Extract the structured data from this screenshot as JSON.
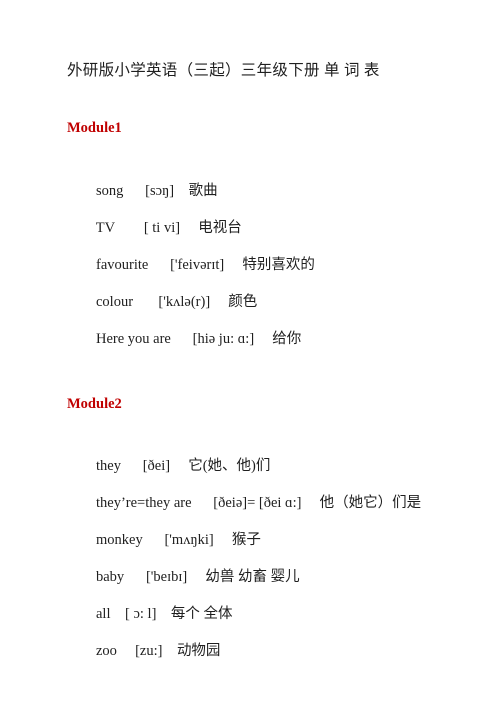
{
  "document": {
    "title": "外研版小学英语（三起）三年级下册 单 词 表",
    "heading_color": "#c00000",
    "background_color": "#ffffff",
    "text_color": "#1f1f1f"
  },
  "modules": [
    {
      "heading": "Module1",
      "entries": [
        {
          "term": "song",
          "gap1": "      ",
          "phonetic": "[sɔŋ]",
          "gap2": "    ",
          "meaning": "歌曲"
        },
        {
          "term": "TV",
          "gap1": "        ",
          "phonetic": "[ ti vi]",
          "gap2": "     ",
          "meaning": "电视台"
        },
        {
          "term": "favourite",
          "gap1": "      ",
          "phonetic": "['feivərɪt]",
          "gap2": "     ",
          "meaning": "特别喜欢的"
        },
        {
          "term": "colour",
          "gap1": "       ",
          "phonetic": "['kʌlə(r)]",
          "gap2": "     ",
          "meaning": "颜色"
        },
        {
          "term": "Here you are",
          "gap1": "      ",
          "phonetic": "[hiə ju: ɑ:]",
          "gap2": "     ",
          "meaning": "给你"
        }
      ]
    },
    {
      "heading": "Module2",
      "entries": [
        {
          "term": "they",
          "gap1": "      ",
          "phonetic": "[ðei]",
          "gap2": "     ",
          "meaning": "它(她、他)们"
        },
        {
          "term": "they’re=they are",
          "gap1": "      ",
          "phonetic": "[ðeiə]= [ðei ɑ:]",
          "gap2": "     ",
          "meaning": "他（她它）们是"
        },
        {
          "term": "monkey",
          "gap1": "      ",
          "phonetic": "['mʌŋki]",
          "gap2": "     ",
          "meaning": "猴子"
        },
        {
          "term": "baby",
          "gap1": "      ",
          "phonetic": "['beɪbɪ]",
          "gap2": "     ",
          "meaning": "幼兽 幼畜 婴儿"
        },
        {
          "term": "all",
          "gap1": "    ",
          "phonetic": "[ ɔ: l]",
          "gap2": "    ",
          "meaning": "每个 全体"
        },
        {
          "term": "zoo",
          "gap1": "     ",
          "phonetic": "[zu:]",
          "gap2": "    ",
          "meaning": "动物园"
        }
      ]
    }
  ]
}
